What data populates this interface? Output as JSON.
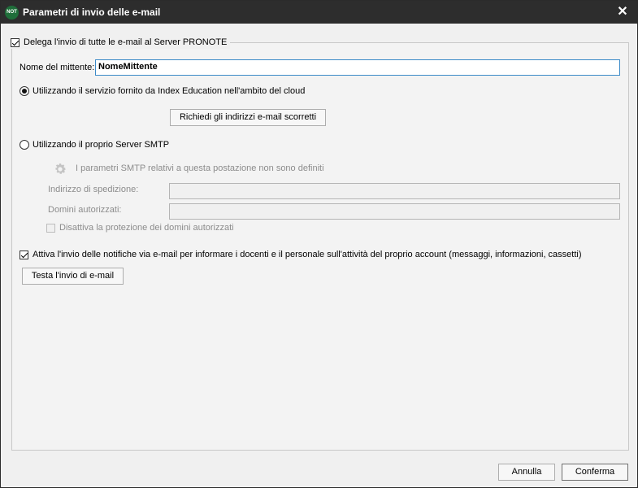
{
  "window": {
    "app_icon_text": "NOT",
    "title": "Parametri di invio delle e-mail",
    "close_symbol": "✕"
  },
  "delegate": {
    "checked": true,
    "label": "Delega l'invio di tutte le e-mail al Server PRONOTE"
  },
  "sender": {
    "label": "Nome del mittente:",
    "value": "NomeMittente"
  },
  "cloud_option": {
    "selected": true,
    "label": "Utilizzando il servizio fornito da Index Education nell'ambito del cloud",
    "button_label": "Richiedi gli indirizzi e-mail scorretti"
  },
  "smtp_option": {
    "selected": false,
    "label": "Utilizzando il proprio Server SMTP",
    "info_icon": "gear-icon",
    "info_text": "I parametri SMTP relativi a questa postazione non sono definiti",
    "address_label": "Indirizzo di spedizione:",
    "address_value": "",
    "domains_label": "Domini autorizzati:",
    "domains_value": "",
    "disable_protection_label": "Disattiva la protezione dei domini autorizzati",
    "disable_protection_checked": false
  },
  "notifications": {
    "checked": true,
    "label": "Attiva l'invio delle notifiche via e-mail per informare i docenti e il personale sull'attività del proprio account (messaggi, informazioni, cassetti)",
    "test_button_label": "Testa l'invio di e-mail"
  },
  "footer": {
    "cancel_label": "Annulla",
    "confirm_label": "Conferma"
  }
}
